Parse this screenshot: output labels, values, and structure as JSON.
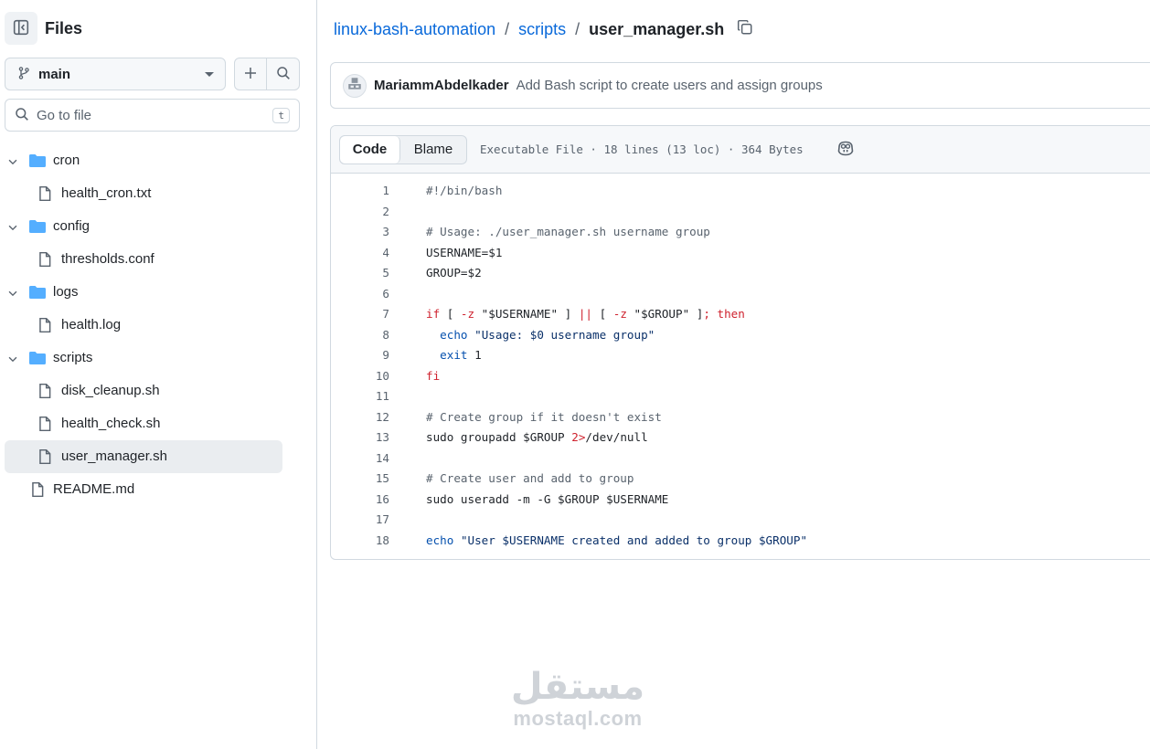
{
  "sidebar": {
    "title": "Files",
    "branch": "main",
    "search_placeholder": "Go to file",
    "search_shortcut": "t",
    "tree": [
      {
        "type": "folder",
        "level": 0,
        "name": "cron"
      },
      {
        "type": "file",
        "level": 1,
        "name": "health_cron.txt"
      },
      {
        "type": "folder",
        "level": 0,
        "name": "config"
      },
      {
        "type": "file",
        "level": 1,
        "name": "thresholds.conf"
      },
      {
        "type": "folder",
        "level": 0,
        "name": "logs"
      },
      {
        "type": "file",
        "level": 1,
        "name": "health.log"
      },
      {
        "type": "folder",
        "level": 0,
        "name": "scripts"
      },
      {
        "type": "file",
        "level": 1,
        "name": "disk_cleanup.sh"
      },
      {
        "type": "file",
        "level": 1,
        "name": "health_check.sh"
      },
      {
        "type": "file",
        "level": 1,
        "name": "user_manager.sh",
        "selected": true
      },
      {
        "type": "file",
        "level": "root",
        "name": "README.md"
      }
    ]
  },
  "breadcrumb": {
    "repo": "linux-bash-automation",
    "folder": "scripts",
    "file": "user_manager.sh",
    "separator": "/"
  },
  "commit": {
    "author": "MariammAbdelkader",
    "message": "Add Bash script to create users and assign groups"
  },
  "file_view": {
    "tab_code": "Code",
    "tab_blame": "Blame",
    "meta": "Executable File · 18 lines (13 loc) · 364 Bytes"
  },
  "code_lines": [
    {
      "n": "1",
      "parts": [
        [
          "c-com",
          "#!/bin/bash"
        ]
      ]
    },
    {
      "n": "2",
      "parts": []
    },
    {
      "n": "3",
      "parts": [
        [
          "c-com",
          "# Usage: ./user_manager.sh username group"
        ]
      ]
    },
    {
      "n": "4",
      "parts": [
        [
          "",
          "USERNAME=$1"
        ]
      ]
    },
    {
      "n": "5",
      "parts": [
        [
          "",
          "GROUP=$2"
        ]
      ]
    },
    {
      "n": "6",
      "parts": []
    },
    {
      "n": "7",
      "parts": [
        [
          "c-key",
          "if"
        ],
        [
          "",
          " [ "
        ],
        [
          "c-key",
          "-z"
        ],
        [
          "",
          " \"$USERNAME\" ] "
        ],
        [
          "c-key",
          "||"
        ],
        [
          "",
          " [ "
        ],
        [
          "c-key",
          "-z"
        ],
        [
          "",
          " \"$GROUP\" ]"
        ],
        [
          "c-key",
          "; then"
        ]
      ]
    },
    {
      "n": "8",
      "parts": [
        [
          "",
          "  "
        ],
        [
          "c-blt",
          "echo"
        ],
        [
          "",
          " "
        ],
        [
          "c-str",
          "\"Usage: $0 username group\""
        ]
      ]
    },
    {
      "n": "9",
      "parts": [
        [
          "",
          "  "
        ],
        [
          "c-blt",
          "exit"
        ],
        [
          "",
          " 1"
        ]
      ]
    },
    {
      "n": "10",
      "parts": [
        [
          "c-key",
          "fi"
        ]
      ]
    },
    {
      "n": "11",
      "parts": []
    },
    {
      "n": "12",
      "parts": [
        [
          "c-com",
          "# Create group if it doesn't exist"
        ]
      ]
    },
    {
      "n": "13",
      "parts": [
        [
          "",
          "sudo groupadd $GROUP "
        ],
        [
          "c-key",
          "2>"
        ],
        [
          "",
          "/dev/null"
        ]
      ]
    },
    {
      "n": "14",
      "parts": []
    },
    {
      "n": "15",
      "parts": [
        [
          "c-com",
          "# Create user and add to group"
        ]
      ]
    },
    {
      "n": "16",
      "parts": [
        [
          "",
          "sudo useradd -m -G $GROUP $USERNAME"
        ]
      ]
    },
    {
      "n": "17",
      "parts": []
    },
    {
      "n": "18",
      "parts": [
        [
          "c-blt",
          "echo"
        ],
        [
          "",
          " "
        ],
        [
          "c-str",
          "\"User $USERNAME created and added to group $GROUP\""
        ]
      ]
    }
  ],
  "watermark": {
    "arabic": "مستقل",
    "latin": "mostaql.com"
  },
  "colors": {
    "link": "#0969da",
    "folder": "#54aeff",
    "border": "#d1d9e0",
    "muted": "#59636e"
  }
}
